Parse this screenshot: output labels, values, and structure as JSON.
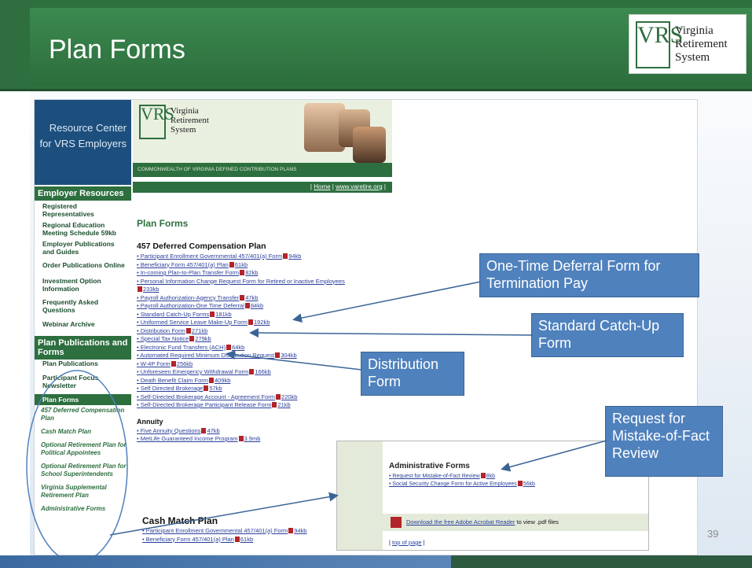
{
  "slide": {
    "title": "Plan Forms",
    "page_number": "39",
    "logo_letters": "VRS",
    "logo_text": [
      "Virginia",
      "Retirement",
      "System"
    ]
  },
  "sidebar": {
    "resource_center": [
      "Resource Center",
      "for VRS Employers"
    ],
    "employer_resources_heading": "Employer Resources",
    "employer_items": [
      "Registered Representatives",
      "Regional Education Meeting Schedule 59kb",
      "Employer Publications and Guides",
      "Order Publications Online",
      "Investment Option Information",
      "Frequently Asked Questions",
      "Webinar Archive"
    ],
    "plan_pub_heading": "Plan Publications and Forms",
    "plan_items": [
      "Plan Publications",
      "Participant Focus Newsletter",
      "Plan Forms"
    ],
    "plan_subitems": [
      "457 Deferred Compensation Plan",
      "Cash Match Plan",
      "Optional Retirement Plan for Political Appointees",
      "Optional Retirement Plan for School Superintendents",
      "Virginia Supplemental Retirement Plan",
      "Administrative Forms"
    ]
  },
  "banner": {
    "logo_text": [
      "Virginia",
      "Retirement",
      "System"
    ],
    "tagline": "COMMONWEALTH OF VIRGINIA DEFINED CONTRIBUTION PLANS",
    "nav_home": "Home",
    "nav_site": "www.varetire.org"
  },
  "content": {
    "page_title": "Plan Forms",
    "section_457": "457 Deferred Compensation Plan",
    "links_457": [
      {
        "text": "Participant Enrollment Governmental 457/401(a) Form",
        "size": "94kb"
      },
      {
        "text": "Beneficiary Form 457/401(a) Plan",
        "size": "61kb"
      },
      {
        "text": "In-coming Plan-to-Plan Transfer Form",
        "size": "82kb"
      },
      {
        "text": "Personal Information Change Request Form for Retired or Inactive Employees",
        "size": ""
      },
      {
        "text": "",
        "size": "233kb"
      },
      {
        "text": "Payroll Authorization-Agency Transfer",
        "size": "47kb"
      },
      {
        "text": "Payroll Authorization-One Time Deferral",
        "size": "84kb"
      },
      {
        "text": "Standard Catch-Up Forms",
        "size": "181kb"
      },
      {
        "text": "Uniformed Service Leave Make-Up Form",
        "size": "192kb"
      },
      {
        "text": "Distribution Form",
        "size": "271kb"
      },
      {
        "text": "Special Tax Notice",
        "size": "279kb"
      },
      {
        "text": "Electronic Fund Transfers (ACH)",
        "size": "64kb"
      },
      {
        "text": "Automated Required Minimum Distribution Request",
        "size": "304kb"
      },
      {
        "text": "W-4P Form",
        "size": "256kb"
      },
      {
        "text": "Unforeseen Emergency Withdrawal Form",
        "size": "166kb"
      },
      {
        "text": "Death Benefit Claim Form",
        "size": "409kb"
      },
      {
        "text": "Self Directed Brokerage",
        "size": "57kb"
      },
      {
        "text": "Self-Directed Brokerage Account - Agreement Form",
        "size": "220kb"
      },
      {
        "text": "Self-Directed Brokerage Participant Release Form",
        "size": "21kb"
      }
    ],
    "annuity_title": "Annuity",
    "annuity_links": [
      {
        "text": "Five Annuity Questions",
        "size": "47kb"
      },
      {
        "text": "MetLife Guaranteed Income Program",
        "size": "3.9mb"
      }
    ],
    "cash_title": "Cash Match Plan",
    "cash_links": [
      {
        "text": "Participant Enrollment Governmental 457/401(a) Form",
        "size": "94kb"
      },
      {
        "text": "Beneficiary Form 457/401(a) Plan",
        "size": "61kb"
      }
    ]
  },
  "inset": {
    "title": "Administrative Forms",
    "links": [
      {
        "text": "Request for Mistake-of-Fact Review",
        "size": "8kb"
      },
      {
        "text": "Social Security Change Form for Active Employees",
        "size": "56kb"
      }
    ],
    "acrobat_link": "Download the free Adobe Acrobat Reader",
    "acrobat_suffix": "to view .pdf files",
    "top_of_page": "top of page"
  },
  "callouts": {
    "one_time": "One-Time Deferral Form for Termination Pay",
    "catch_up": "Standard Catch-Up Form",
    "distribution": "Distribution Form",
    "mistake": "Request for Mistake-of-Fact Review"
  },
  "colors": {
    "brand_green": "#2d6f3f",
    "callout_blue": "#4f81bd",
    "link_blue": "#2b3f9a",
    "pdf_red": "#b3242a"
  }
}
